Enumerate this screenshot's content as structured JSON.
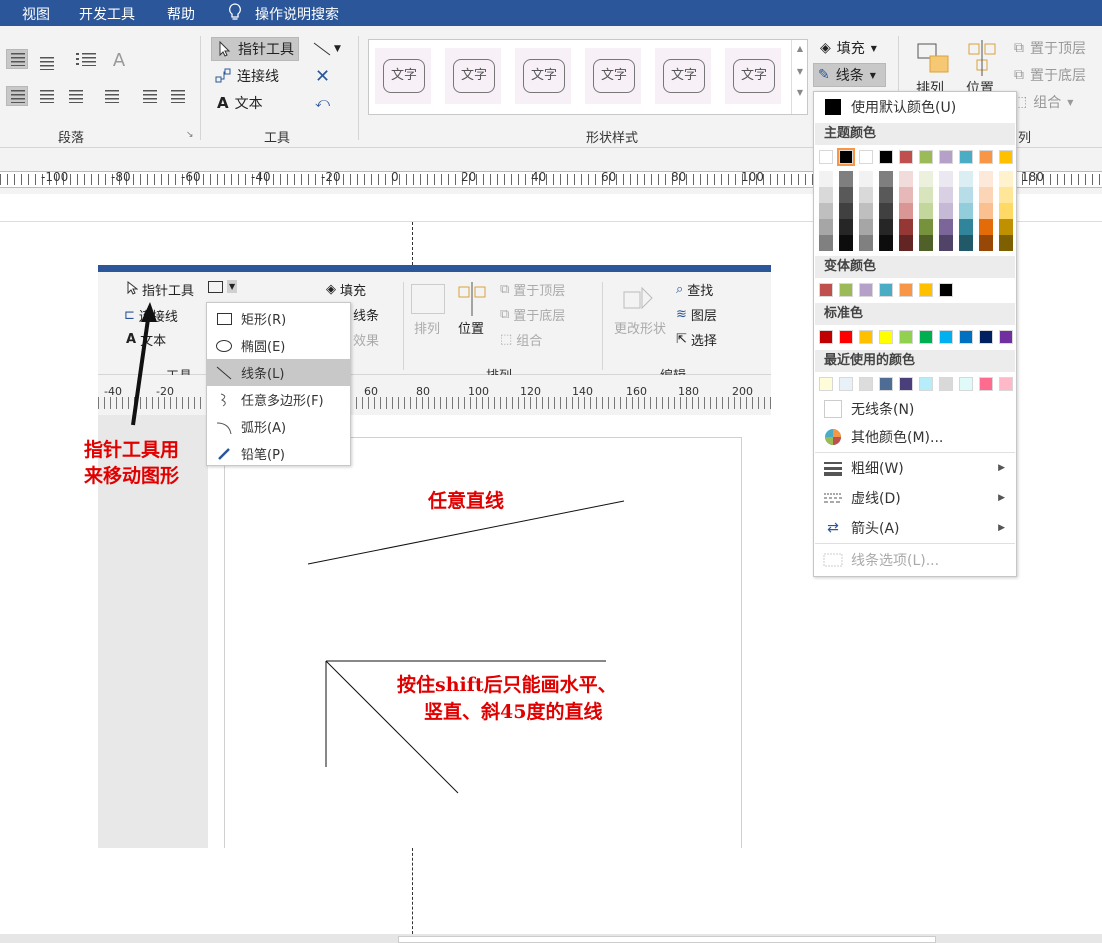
{
  "menubar": {
    "items": [
      "视图",
      "开发工具",
      "帮助"
    ],
    "search": "操作说明搜索"
  },
  "ribbon": {
    "groups": {
      "paragraph": "段落",
      "tools": "工具",
      "shape_styles": "形状样式",
      "arrange_partial": "列"
    },
    "tools": {
      "pointer": "指针工具",
      "connector": "连接线",
      "text": "文本"
    },
    "styles": [
      "文字",
      "文字",
      "文字",
      "文字",
      "文字",
      "文字"
    ],
    "fill": "填充",
    "line": "线条",
    "arrange": {
      "bring_front": "置于顶层",
      "send_back": "置于底层",
      "group": "组合",
      "arrange_label": "排列",
      "position_label": "位置"
    }
  },
  "ruler": {
    "labels": [
      "-100",
      "-80",
      "-60",
      "-40",
      "-20",
      "0",
      "20",
      "40",
      "60",
      "80",
      "100",
      "180"
    ]
  },
  "inner": {
    "tools": {
      "pointer": "指针工具",
      "connector": "连接线",
      "text": "文本",
      "group": "工具"
    },
    "fill": "填充",
    "line": "线条",
    "effect": "效果",
    "arrange": {
      "bring_front": "置于顶层",
      "send_back": "置于底层",
      "group": "组合",
      "arrange": "排列",
      "position": "位置",
      "group_label": "排列"
    },
    "edit": {
      "change_shape": "更改形状",
      "find": "查找",
      "layer": "图层",
      "select": "选择",
      "group_label": "编辑"
    },
    "ruler": [
      "-40",
      "-20",
      "60",
      "80",
      "100",
      "120",
      "140",
      "160",
      "180",
      "200"
    ],
    "shape_menu": [
      {
        "label": "矩形(R)",
        "icon": "rectangle-icon"
      },
      {
        "label": "椭圆(E)",
        "icon": "ellipse-icon"
      },
      {
        "label": "线条(L)",
        "icon": "line-icon"
      },
      {
        "label": "任意多边形(F)",
        "icon": "freeform-icon"
      },
      {
        "label": "弧形(A)",
        "icon": "arc-icon"
      },
      {
        "label": "铅笔(P)",
        "icon": "pencil-icon"
      }
    ]
  },
  "annotations": {
    "pointer_note_1": "指针工具用",
    "pointer_note_2": "来移动图形",
    "free_line": "任意直线",
    "shift_note_1": "按住shift后只能画水平、",
    "shift_note_2": "竖直、斜45度的直线"
  },
  "color_dropdown": {
    "default_color": "使用默认颜色(U)",
    "theme_header": "主题颜色",
    "variant_header": "变体颜色",
    "standard_header": "标准色",
    "recent_header": "最近使用的颜色",
    "no_line": "无线条(N)",
    "more_colors": "其他颜色(M)...",
    "weight": "粗细(W)",
    "dash": "虚线(D)",
    "arrow": "箭头(A)",
    "line_options": "线条选项(L)...",
    "theme_top": [
      "#ffffff",
      "#000000",
      "#ffffff",
      "#000000",
      "#c0504d",
      "#9bbb59",
      "#b4a0c8",
      "#4bacc6",
      "#f79646",
      "#ffc000"
    ],
    "theme_cols": [
      [
        "#f2f2f2",
        "#d9d9d9",
        "#bfbfbf",
        "#a6a6a6",
        "#808080"
      ],
      [
        "#7f7f7f",
        "#595959",
        "#404040",
        "#262626",
        "#0d0d0d"
      ],
      [
        "#f2f2f2",
        "#d9d9d9",
        "#bfbfbf",
        "#a6a6a6",
        "#808080"
      ],
      [
        "#7f7f7f",
        "#595959",
        "#404040",
        "#262626",
        "#0d0d0d"
      ],
      [
        "#f2dcdb",
        "#e6b9b8",
        "#d99694",
        "#953734",
        "#632523"
      ],
      [
        "#ebf1dd",
        "#d7e4bc",
        "#c3d69b",
        "#76923c",
        "#4f6128"
      ],
      [
        "#ece8f1",
        "#d9d1e3",
        "#c6b9d5",
        "#7c6598",
        "#514268"
      ],
      [
        "#dbeef3",
        "#b7dde8",
        "#92cddc",
        "#31859b",
        "#215968"
      ],
      [
        "#fde9d9",
        "#fbd5b5",
        "#fac08f",
        "#e36c09",
        "#974806"
      ],
      [
        "#fff2cc",
        "#ffe699",
        "#ffd966",
        "#bf9000",
        "#7f6000"
      ]
    ],
    "variant": [
      "#c0504d",
      "#9bbb59",
      "#b4a0c8",
      "#4bacc6",
      "#f79646",
      "#ffc000",
      "#000000"
    ],
    "standard": [
      "#c00000",
      "#ff0000",
      "#ffc000",
      "#ffff00",
      "#92d050",
      "#00b050",
      "#00b0f0",
      "#0070c0",
      "#002060",
      "#7030a0"
    ],
    "recent": [
      "#fffcd9",
      "#e8f0f8",
      "#dcdcdc",
      "#4f6d94",
      "#4a3f7a",
      "#b7ecfb",
      "#d9d9d9",
      "#e0fafa",
      "#ff6b8e",
      "#ffb8c8"
    ]
  }
}
